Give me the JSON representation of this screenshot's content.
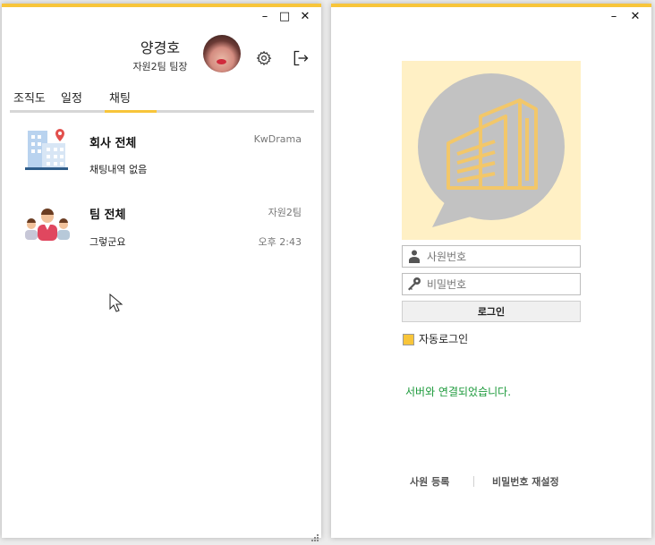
{
  "left_window": {
    "controls": {
      "minimize": "–",
      "maximize": "□",
      "close": "✕"
    },
    "profile": {
      "name": "양경호",
      "subtitle": "자원2팀 팀장"
    },
    "tabs": [
      {
        "label": "조직도",
        "active": false
      },
      {
        "label": "일정",
        "active": false
      },
      {
        "label": "채팅",
        "active": true
      }
    ],
    "chats": [
      {
        "title": "회사 전체",
        "tag": "KwDrama",
        "message": "채팅내역 없음",
        "time": "",
        "icon": "company-building-icon"
      },
      {
        "title": "팀 전체",
        "tag": "자원2팀",
        "message": "그렇군요",
        "time": "오후 2:43",
        "icon": "team-people-icon"
      }
    ]
  },
  "right_window": {
    "controls": {
      "minimize": "–",
      "close": "✕"
    },
    "employee_id_placeholder": "사원번호",
    "password_placeholder": "비밀번호",
    "login_label": "로그인",
    "auto_login_label": "자동로그인",
    "auto_login_checked": true,
    "status_message": "서버와 연결되었습니다.",
    "register_label": "사원 등록",
    "reset_password_label": "비밀번호 재설정"
  },
  "colors": {
    "accent": "#f8c53a",
    "status_green": "#1d9a3c",
    "logo_bg": "#fff0c5",
    "bubble_gray": "#c2c2c2"
  }
}
